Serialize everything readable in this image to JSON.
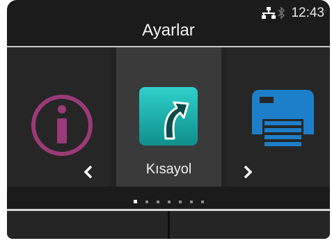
{
  "status_bar": {
    "time": "12:43",
    "network_icon": "wired-network-icon",
    "bluetooth_icon": "bluetooth-icon"
  },
  "header": {
    "title": "Ayarlar"
  },
  "carousel": {
    "items": [
      {
        "icon": "info-icon",
        "label": "",
        "color": "#9b3a78"
      },
      {
        "icon": "shortcut-icon",
        "label": "Kısayol",
        "color": "#1fb7b4",
        "selected": true
      },
      {
        "icon": "printer-icon",
        "label": "",
        "color": "#1d7fc9"
      }
    ],
    "prev_icon": "chevron-left-icon",
    "next_icon": "chevron-right-icon"
  },
  "page_indicator": {
    "total": 7,
    "current": 1
  },
  "softkeys": {
    "left_label": "",
    "right_label": ""
  }
}
